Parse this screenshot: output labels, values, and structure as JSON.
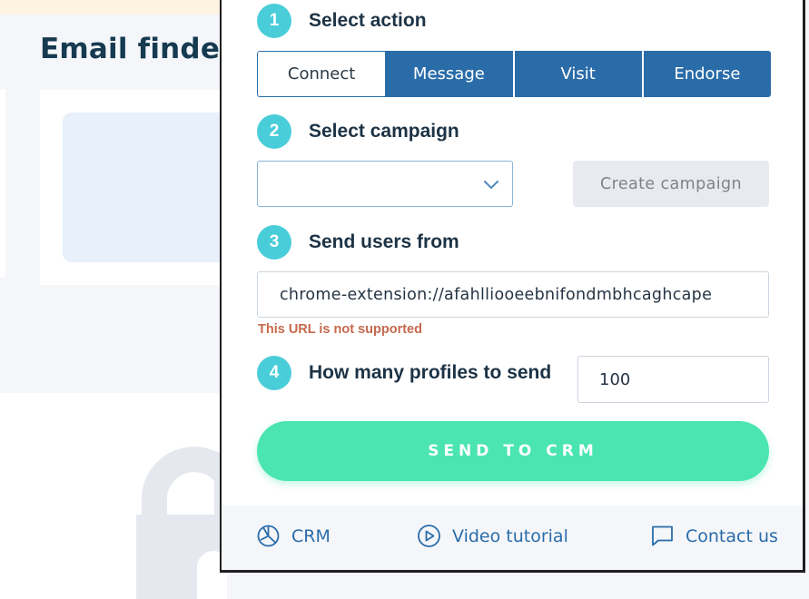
{
  "background": {
    "title": "Email finder"
  },
  "steps": [
    {
      "number": "1",
      "label": "Select action"
    },
    {
      "number": "2",
      "label": "Select campaign"
    },
    {
      "number": "3",
      "label": "Send users from"
    },
    {
      "number": "4",
      "label": "How many profiles to send"
    }
  ],
  "actions": [
    {
      "label": "Connect",
      "selected": true
    },
    {
      "label": "Message",
      "selected": false
    },
    {
      "label": "Visit",
      "selected": false
    },
    {
      "label": "Endorse",
      "selected": false
    }
  ],
  "campaign": {
    "selected_value": "",
    "create_button": "Create campaign"
  },
  "source": {
    "url": "chrome-extension://afahllioo​eebnifondmbhcaghcape",
    "error": "This URL is not supported"
  },
  "profiles": {
    "count": "100"
  },
  "send_button": "SEND TO CRM",
  "footer": {
    "crm": "CRM",
    "video": "Video tutorial",
    "contact": "Contact us"
  },
  "colors": {
    "accent_blue": "#2a6ca8",
    "step_badge": "#49cdd9",
    "send_green": "#4ae5b0",
    "error": "#c5694d"
  },
  "icons": [
    "chevron-down-icon",
    "crm-chart-icon",
    "play-icon",
    "chat-icon",
    "lock-icon"
  ]
}
